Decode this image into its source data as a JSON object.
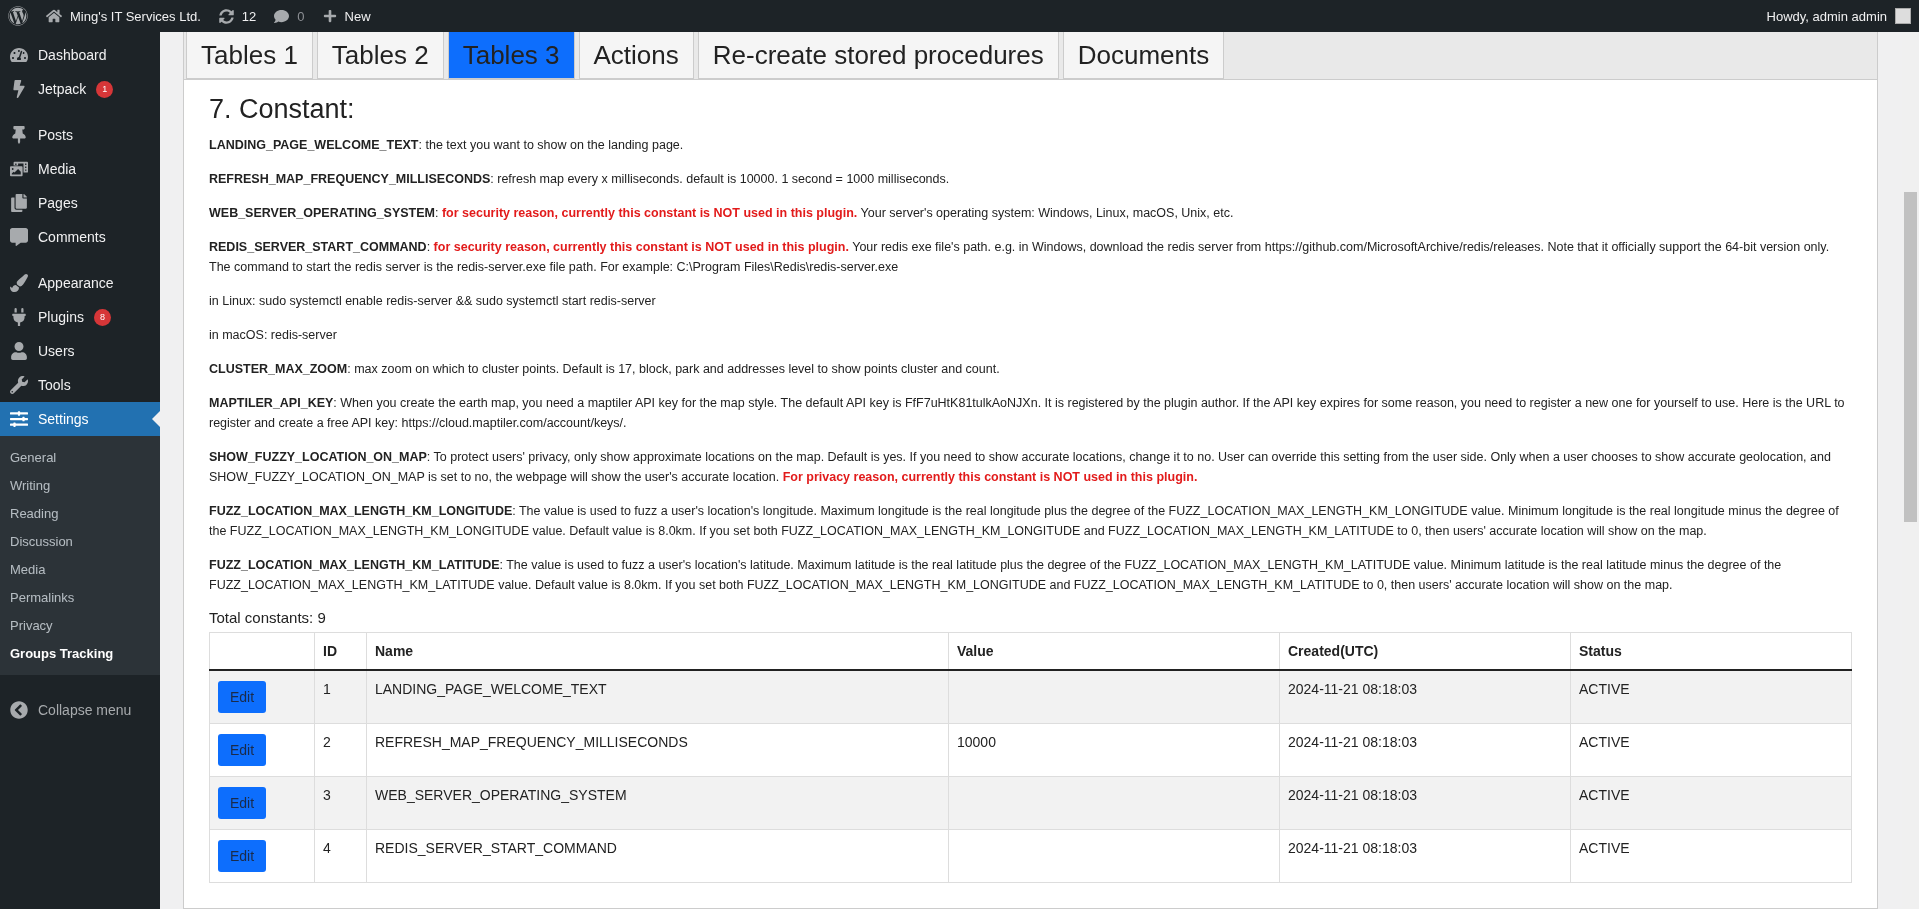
{
  "admin_bar": {
    "site_name": "Ming's IT Services Ltd.",
    "updates": "12",
    "comments": "0",
    "new_label": "New",
    "greeting": "Howdy, admin admin"
  },
  "sidebar": {
    "groups": [
      [
        {
          "label": "Dashboard",
          "selected": false
        },
        {
          "label": "Jetpack",
          "badge": "1",
          "selected": false
        }
      ],
      [
        {
          "label": "Posts",
          "selected": false
        },
        {
          "label": "Media",
          "selected": false
        },
        {
          "label": "Pages",
          "selected": false
        },
        {
          "label": "Comments",
          "selected": false
        }
      ],
      [
        {
          "label": "Appearance",
          "selected": false
        },
        {
          "label": "Plugins",
          "badge": "8",
          "selected": false
        },
        {
          "label": "Users",
          "selected": false
        },
        {
          "label": "Tools",
          "selected": false
        },
        {
          "label": "Settings",
          "selected": true
        }
      ]
    ],
    "submenu": [
      {
        "label": "General",
        "selected": false
      },
      {
        "label": "Writing",
        "selected": false
      },
      {
        "label": "Reading",
        "selected": false
      },
      {
        "label": "Discussion",
        "selected": false
      },
      {
        "label": "Media",
        "selected": false
      },
      {
        "label": "Permalinks",
        "selected": false
      },
      {
        "label": "Privacy",
        "selected": false
      },
      {
        "label": "Groups Tracking",
        "selected": true
      }
    ],
    "collapse": "Collapse menu"
  },
  "tabs": [
    {
      "label": "Tables 1",
      "selected": false
    },
    {
      "label": "Tables 2",
      "selected": false
    },
    {
      "label": "Tables 3",
      "selected": true
    },
    {
      "label": "Actions",
      "selected": false
    },
    {
      "label": "Re-create stored procedures",
      "selected": false
    },
    {
      "label": "Documents",
      "selected": false
    }
  ],
  "heading": "7. Constant:",
  "paragraphs": [
    [
      {
        "kind": "term",
        "text": "LANDING_PAGE_WELCOME_TEXT"
      },
      {
        "kind": "plain",
        "text": ": the text you want to show on the landing page."
      }
    ],
    [
      {
        "kind": "term",
        "text": "REFRESH_MAP_FREQUENCY_MILLISECONDS"
      },
      {
        "kind": "plain",
        "text": ": refresh map every x milliseconds. default is 10000. 1 second = 1000 milliseconds."
      }
    ],
    [
      {
        "kind": "term",
        "text": "WEB_SERVER_OPERATING_SYSTEM"
      },
      {
        "kind": "plain",
        "text": ": "
      },
      {
        "kind": "warning",
        "text": "for security reason, currently this constant is NOT used in this plugin."
      },
      {
        "kind": "plain",
        "text": " Your server's operating system: Windows, Linux, macOS, Unix, etc."
      }
    ],
    [
      {
        "kind": "term",
        "text": "REDIS_SERVER_START_COMMAND"
      },
      {
        "kind": "plain",
        "text": ": "
      },
      {
        "kind": "warning",
        "text": "for security reason, currently this constant is NOT used in this plugin."
      },
      {
        "kind": "plain",
        "text": " Your redis exe file's path. e.g. in Windows, download the redis server from https://github.com/MicrosoftArchive/redis/releases. Note that it officially support the 64-bit version only. The command to start the redis server is the redis-server.exe file path. For example: C:\\Program Files\\Redis\\redis-server.exe"
      }
    ],
    [
      {
        "kind": "plain",
        "text": "in Linux: sudo systemctl enable redis-server && sudo systemctl start redis-server"
      }
    ],
    [
      {
        "kind": "plain",
        "text": "in macOS: redis-server"
      }
    ],
    [
      {
        "kind": "term",
        "text": "CLUSTER_MAX_ZOOM"
      },
      {
        "kind": "plain",
        "text": ": max zoom on which to cluster points. Default is 17, block, park and addresses level to show points cluster and count."
      }
    ],
    [
      {
        "kind": "term",
        "text": "MAPTILER_API_KEY"
      },
      {
        "kind": "plain",
        "text": ": When you create the earth map, you need a maptiler API key for the map style. The default API key is FfF7uHtK81tulkAoNJXn. It is registered by the plugin author. If the API key expires for some reason, you need to register a new one for yourself to use. Here is the URL to register and create a free API key: https://cloud.maptiler.com/account/keys/."
      }
    ],
    [
      {
        "kind": "term",
        "text": "SHOW_FUZZY_LOCATION_ON_MAP"
      },
      {
        "kind": "plain",
        "text": ": To protect users' privacy, only show approximate locations on the map. Default is yes. If you need to show accurate locations, change it to no. User can override this setting from the user side. Only when a user chooses to show accurate geolocation, and SHOW_FUZZY_LOCATION_ON_MAP is set to no, the webpage will show the user's accurate location. "
      },
      {
        "kind": "warning",
        "text": "For privacy reason, currently this constant is NOT used in this plugin."
      }
    ],
    [
      {
        "kind": "term",
        "text": "FUZZ_LOCATION_MAX_LENGTH_KM_LONGITUDE"
      },
      {
        "kind": "plain",
        "text": ": The value is used to fuzz a user's location's longitude. Maximum longitude is the real longitude plus the degree of the FUZZ_LOCATION_MAX_LENGTH_KM_LONGITUDE value. Minimum longitude is the real longitude minus the degree of the FUZZ_LOCATION_MAX_LENGTH_KM_LONGITUDE value. Default value is 8.0km. If you set both FUZZ_LOCATION_MAX_LENGTH_KM_LONGITUDE and FUZZ_LOCATION_MAX_LENGTH_KM_LATITUDE to 0, then users' accurate location will show on the map."
      }
    ],
    [
      {
        "kind": "term",
        "text": "FUZZ_LOCATION_MAX_LENGTH_KM_LATITUDE"
      },
      {
        "kind": "plain",
        "text": ": The value is used to fuzz a user's location's latitude. Maximum latitude is the real latitude plus the degree of the FUZZ_LOCATION_MAX_LENGTH_KM_LATITUDE value. Minimum latitude is the real latitude minus the degree of the FUZZ_LOCATION_MAX_LENGTH_KM_LATITUDE value. Default value is 8.0km. If you set both FUZZ_LOCATION_MAX_LENGTH_KM_LONGITUDE and FUZZ_LOCATION_MAX_LENGTH_KM_LATITUDE to 0, then users' accurate location will show on the map."
      }
    ]
  ],
  "total": "Total constants: 9",
  "table": {
    "columns": [
      "ID",
      "Name",
      "Value",
      "Created(UTC)",
      "Status"
    ],
    "rows": [
      {
        "action": "Edit",
        "cells": [
          "1",
          "LANDING_PAGE_WELCOME_TEXT",
          "",
          "2024-11-21 08:18:03",
          "ACTIVE"
        ]
      },
      {
        "action": "Edit",
        "cells": [
          "2",
          "REFRESH_MAP_FREQUENCY_MILLISECONDS",
          "10000",
          "2024-11-21 08:18:03",
          "ACTIVE"
        ]
      },
      {
        "action": "Edit",
        "cells": [
          "3",
          "WEB_SERVER_OPERATING_SYSTEM",
          "",
          "2024-11-21 08:18:03",
          "ACTIVE"
        ]
      },
      {
        "action": "Edit",
        "cells": [
          "4",
          "REDIS_SERVER_START_COMMAND",
          "",
          "2024-11-21 08:18:03",
          "ACTIVE"
        ]
      }
    ]
  }
}
